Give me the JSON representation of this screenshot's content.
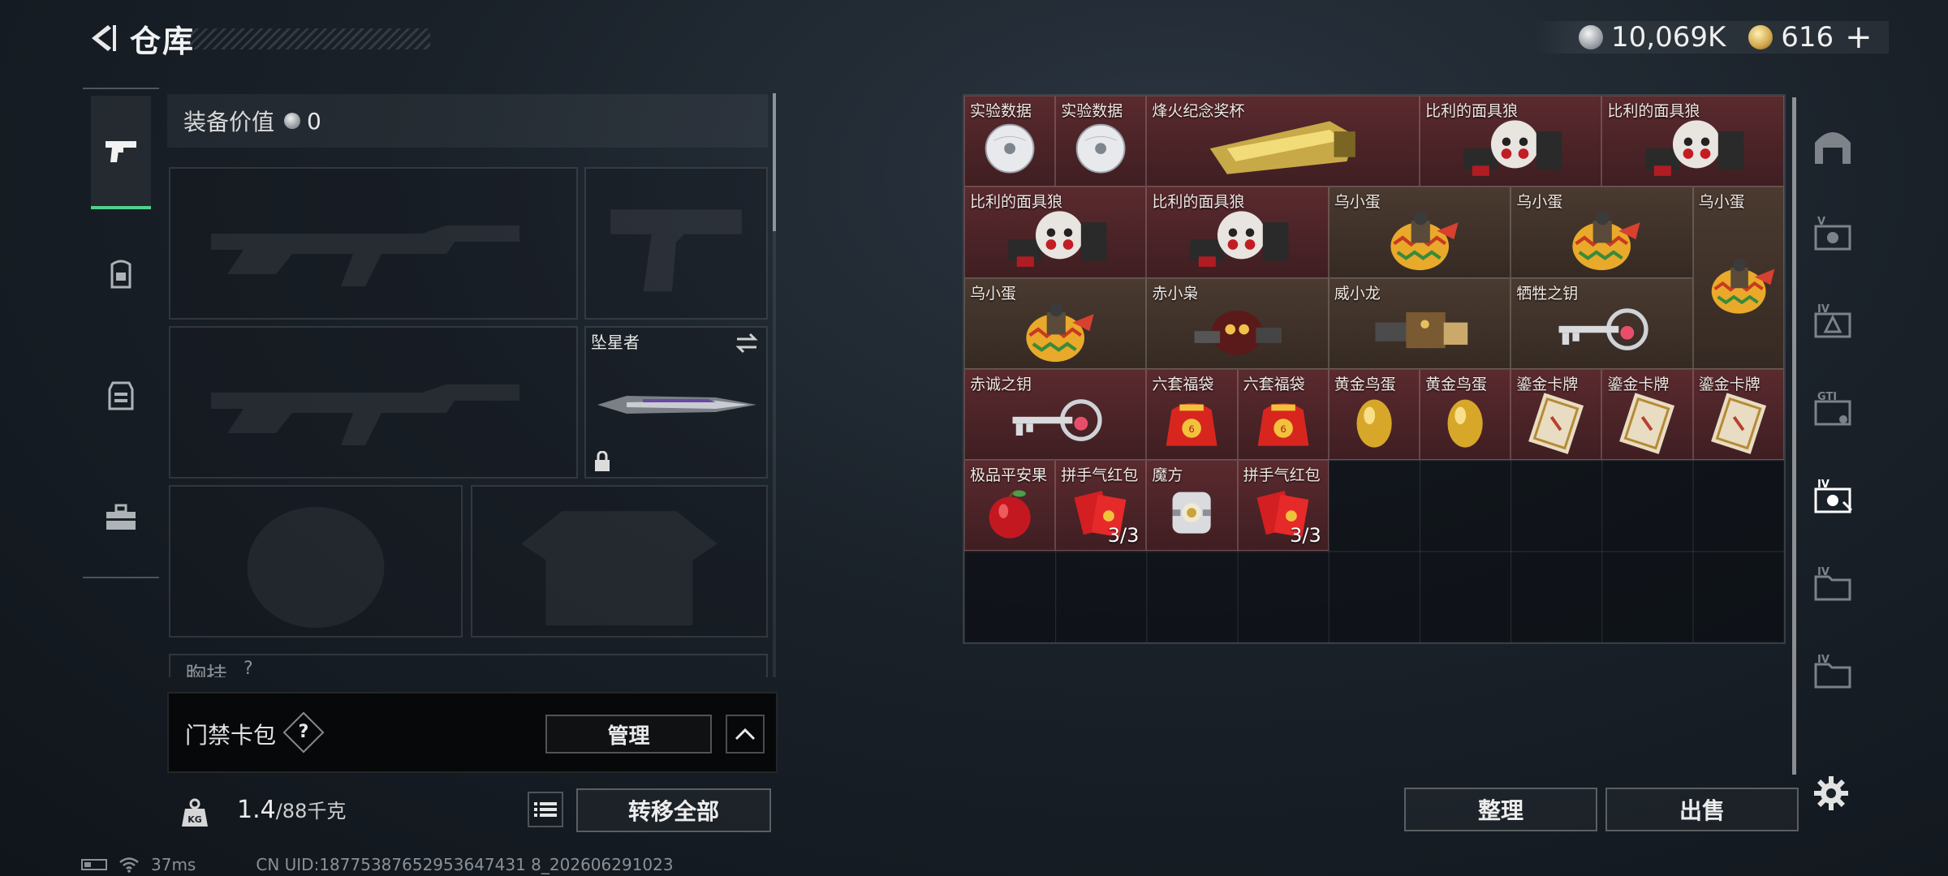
{
  "header": {
    "title": "仓库"
  },
  "currency": {
    "silver_value": "10,069K",
    "gold_value": "616",
    "plus": "+"
  },
  "equipment": {
    "value_label": "装备价值",
    "value_amount": "0",
    "melee_name": "坠星者",
    "chest_label": "胸挂",
    "chest_hint": "?"
  },
  "keycard": {
    "label": "门禁卡包",
    "help": "?",
    "manage_label": "管理"
  },
  "weight": {
    "current": "1.4",
    "max": "/88千克"
  },
  "buttons": {
    "transfer_all": "转移全部",
    "sort": "整理",
    "sell": "出售"
  },
  "status": {
    "ping": "37ms",
    "uid": "CN UID:18775387652953647431 8_202606291023"
  },
  "storage_items": [
    {
      "name": "实验数据",
      "bg": "red",
      "art": "disc"
    },
    {
      "name": "实验数据",
      "bg": "red",
      "art": "disc"
    },
    {
      "name": "烽火纪念奖杯",
      "bg": "red",
      "art": "trophy"
    },
    {
      "name": "比利的面具狼",
      "bg": "red",
      "art": "puppet"
    },
    {
      "name": "比利的面具狼",
      "bg": "red",
      "art": "puppet"
    },
    {
      "name": "比利的面具狼",
      "bg": "red",
      "art": "puppet"
    },
    {
      "name": "比利的面具狼",
      "bg": "red",
      "art": "puppet"
    },
    {
      "name": "乌小蛋",
      "bg": "brown",
      "art": "egg-toy"
    },
    {
      "name": "乌小蛋",
      "bg": "brown",
      "art": "egg-toy"
    },
    {
      "name": "乌小蛋",
      "bg": "brown",
      "art": "egg-toy"
    },
    {
      "name": "乌小蛋",
      "bg": "brown",
      "art": "egg-toy"
    },
    {
      "name": "赤小枭",
      "bg": "brown",
      "art": "owl"
    },
    {
      "name": "威小龙",
      "bg": "brown",
      "art": "dragon"
    },
    {
      "name": "牺牲之钥",
      "bg": "brown",
      "art": "key"
    },
    {
      "name": "赤诚之钥",
      "bg": "red",
      "art": "key"
    },
    {
      "name": "六套福袋",
      "bg": "red",
      "art": "lucky-bag"
    },
    {
      "name": "六套福袋",
      "bg": "red",
      "art": "lucky-bag"
    },
    {
      "name": "黄金鸟蛋",
      "bg": "red",
      "art": "gold-egg"
    },
    {
      "name": "黄金鸟蛋",
      "bg": "red",
      "art": "gold-egg"
    },
    {
      "name": "鎏金卡牌",
      "bg": "red",
      "art": "gold-card"
    },
    {
      "name": "鎏金卡牌",
      "bg": "red",
      "art": "gold-card"
    },
    {
      "name": "鎏金卡牌",
      "bg": "red",
      "art": "gold-card"
    },
    {
      "name": "极品平安果",
      "bg": "red",
      "art": "apple"
    },
    {
      "name": "拼手气红包",
      "bg": "red",
      "art": "red-envelope",
      "count": "3/3"
    },
    {
      "name": "魔方",
      "bg": "red",
      "art": "cube"
    },
    {
      "name": "拼手气红包",
      "bg": "red",
      "art": "red-envelope",
      "count": "3/3"
    }
  ],
  "icons": {
    "back": "back-arrow-icon",
    "pistol": "pistol-icon",
    "backpack": "backpack-icon",
    "vest": "vest-icon",
    "toolbox": "toolbox-icon",
    "weight": "weight-icon",
    "list": "list-icon",
    "settings": "gear-icon"
  },
  "colors": {
    "active_tab": "#4fd18a",
    "red_item_bg": "#5a2a2e",
    "brown_item_bg": "#4a3a30"
  }
}
